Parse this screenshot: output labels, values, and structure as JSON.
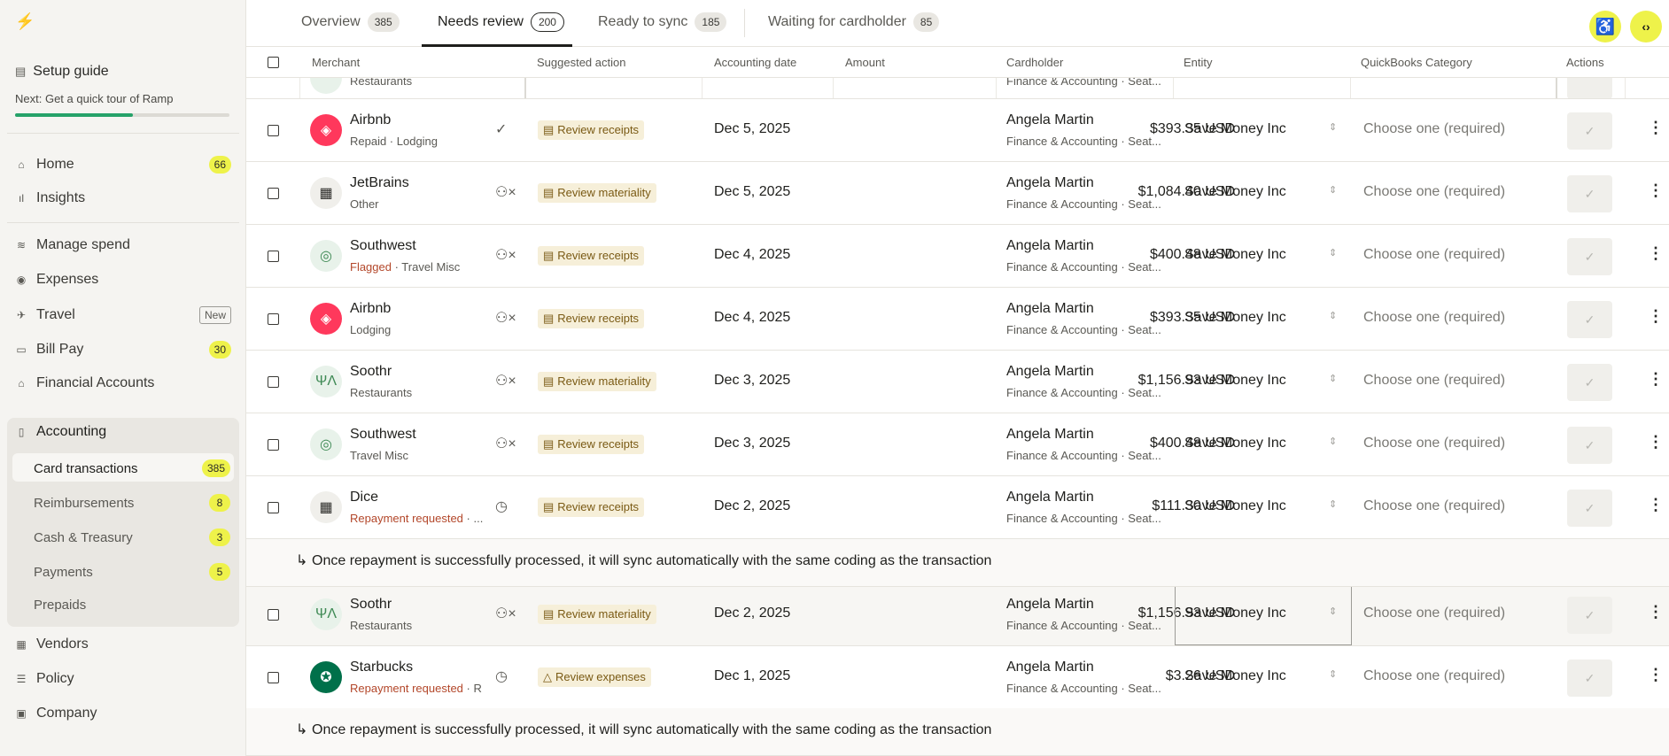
{
  "sidebar": {
    "logo": "⚡",
    "setup_guide": "Setup guide",
    "setup_sub": "Next: Get a quick tour of Ramp",
    "setup_progress": 0.55,
    "nav": [
      {
        "label": "Home",
        "icon": "home-icon",
        "count": "66"
      },
      {
        "label": "Insights",
        "icon": "chart-icon"
      },
      {
        "label": "Manage spend",
        "icon": "layers-icon"
      },
      {
        "label": "Expenses",
        "icon": "dollar-icon"
      },
      {
        "label": "Travel",
        "icon": "plane-icon",
        "badge": "New"
      },
      {
        "label": "Bill Pay",
        "icon": "invoice-icon",
        "count": "30"
      },
      {
        "label": "Financial Accounts",
        "icon": "bank-icon"
      },
      {
        "label": "Accounting",
        "icon": "book-icon"
      }
    ],
    "accounting_sub": [
      {
        "label": "Card transactions",
        "count": "385"
      },
      {
        "label": "Reimbursements",
        "count": "8"
      },
      {
        "label": "Cash & Treasury",
        "count": "3"
      },
      {
        "label": "Payments",
        "count": "5"
      },
      {
        "label": "Prepaids"
      }
    ],
    "bottom": [
      {
        "label": "Vendors",
        "icon": "store-icon"
      },
      {
        "label": "Policy",
        "icon": "policy-icon"
      },
      {
        "label": "Company",
        "icon": "building-icon"
      }
    ]
  },
  "tabs": [
    {
      "label": "Overview",
      "count": "385"
    },
    {
      "label": "Needs review",
      "count": "200"
    },
    {
      "label": "Ready to sync",
      "count": "185"
    },
    {
      "label": "Waiting for cardholder",
      "count": "85"
    }
  ],
  "columns": {
    "merchant": "Merchant",
    "suggested_action": "Suggested action",
    "accounting_date": "Accounting date",
    "amount": "Amount",
    "cardholder": "Cardholder",
    "entity": "Entity",
    "qb_category": "QuickBooks Category",
    "actions": "Actions"
  },
  "partial_row": {
    "merchant_sub": "Restaurants",
    "cardholder_sub": "Finance & Accounting · Seat..."
  },
  "rows": [
    {
      "merchant": "Airbnb",
      "sub": "Repaid · Lodging",
      "status_icon": "check-circle-icon",
      "action": "Review receipts",
      "date": "Dec 5, 2025",
      "amount": "$393.35 USD",
      "cardholder": "Angela Martin",
      "cardholder_sub": "Finance & Accounting · Seat...",
      "entity": "Save Money Inc",
      "category": "Choose one (required)"
    },
    {
      "merchant": "JetBrains",
      "sub": "Other",
      "status_icon": "user-x-icon",
      "action": "Review materiality",
      "date": "Dec 5, 2025",
      "amount": "$1,084.40 USD",
      "cardholder": "Angela Martin",
      "cardholder_sub": "Finance & Accounting · Seat...",
      "entity": "Save Money Inc",
      "category": "Choose one (required)"
    },
    {
      "merchant": "Southwest",
      "flag": "Flagged",
      "sub": " · Travel Misc",
      "status_icon": "user-x-icon",
      "action": "Review receipts",
      "date": "Dec 4, 2025",
      "amount": "$400.48 USD",
      "cardholder": "Angela Martin",
      "cardholder_sub": "Finance & Accounting · Seat...",
      "entity": "Save Money Inc",
      "category": "Choose one (required)"
    },
    {
      "merchant": "Airbnb",
      "sub": "Lodging",
      "status_icon": "user-x-icon",
      "action": "Review receipts",
      "date": "Dec 4, 2025",
      "amount": "$393.35 USD",
      "cardholder": "Angela Martin",
      "cardholder_sub": "Finance & Accounting · Seat...",
      "entity": "Save Money Inc",
      "category": "Choose one (required)"
    },
    {
      "merchant": "Soothr",
      "sub": "Restaurants",
      "status_icon": "user-x-icon",
      "action": "Review materiality",
      "date": "Dec 3, 2025",
      "amount": "$1,156.93 USD",
      "cardholder": "Angela Martin",
      "cardholder_sub": "Finance & Accounting · Seat...",
      "entity": "Save Money Inc",
      "category": "Choose one (required)"
    },
    {
      "merchant": "Southwest",
      "sub": "Travel Misc",
      "status_icon": "user-x-icon",
      "action": "Review receipts",
      "date": "Dec 3, 2025",
      "amount": "$400.48 USD",
      "cardholder": "Angela Martin",
      "cardholder_sub": "Finance & Accounting · Seat...",
      "entity": "Save Money Inc",
      "category": "Choose one (required)"
    },
    {
      "merchant": "Dice",
      "flag": "Repayment requested",
      "sub": " · ...",
      "status_icon": "clock-icon",
      "action": "Review receipts",
      "date": "Dec 2, 2025",
      "amount": "$111.30 USD",
      "cardholder": "Angela Martin",
      "cardholder_sub": "Finance & Accounting · Seat...",
      "entity": "Save Money Inc",
      "category": "Choose one (required)"
    },
    {
      "merchant": "Soothr",
      "sub": "Restaurants",
      "status_icon": "user-x-icon",
      "action": "Review materiality",
      "date": "Dec 2, 2025",
      "amount": "$1,156.93 USD",
      "cardholder": "Angela Martin",
      "cardholder_sub": "Finance & Accounting · Seat...",
      "entity": "Save Money Inc",
      "category": "Choose one (required)"
    },
    {
      "merchant": "Starbucks",
      "flag": "Repayment requested",
      "sub": " · R...",
      "status_icon": "clock-icon",
      "action": "Review expenses",
      "date": "Dec 1, 2025",
      "amount": "$3.26 USD",
      "cardholder": "Angela Martin",
      "cardholder_sub": "Finance & Accounting · Seat...",
      "entity": "Save Money Inc",
      "category": "Choose one (required)"
    }
  ],
  "repayment_note": "Once repayment is successfully processed, it will sync automatically with the same coding as the transaction",
  "colors": {
    "accent": "#eef24a",
    "progress": "#26a269",
    "flag": "#b3472a",
    "airbnb": "#ff385c",
    "starbucks": "#00704a"
  }
}
